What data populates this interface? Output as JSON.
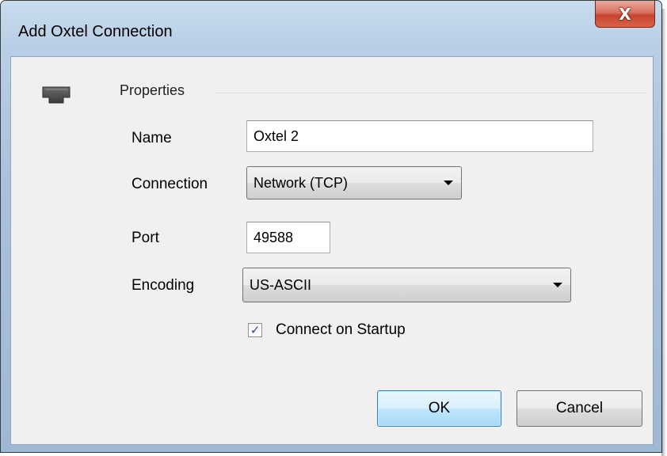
{
  "window": {
    "title": "Add Oxtel Connection",
    "close_glyph": "X"
  },
  "group": {
    "icon": "network-plug-icon",
    "label": "Properties"
  },
  "fields": {
    "name": {
      "label": "Name",
      "value": "Oxtel 2"
    },
    "connection": {
      "label": "Connection",
      "selected": "Network (TCP)"
    },
    "port": {
      "label": "Port",
      "value": "49588"
    },
    "encoding": {
      "label": "Encoding",
      "selected": "US-ASCII"
    },
    "connect_on_startup": {
      "label": "Connect on Startup",
      "checked": true
    }
  },
  "buttons": {
    "ok": "OK",
    "cancel": "Cancel"
  },
  "colors": {
    "title_gradient_top": "#c9dcee",
    "close_red": "#c7442e",
    "client_bg": "#f0f0f0",
    "default_button_border": "#3c7fb1"
  }
}
